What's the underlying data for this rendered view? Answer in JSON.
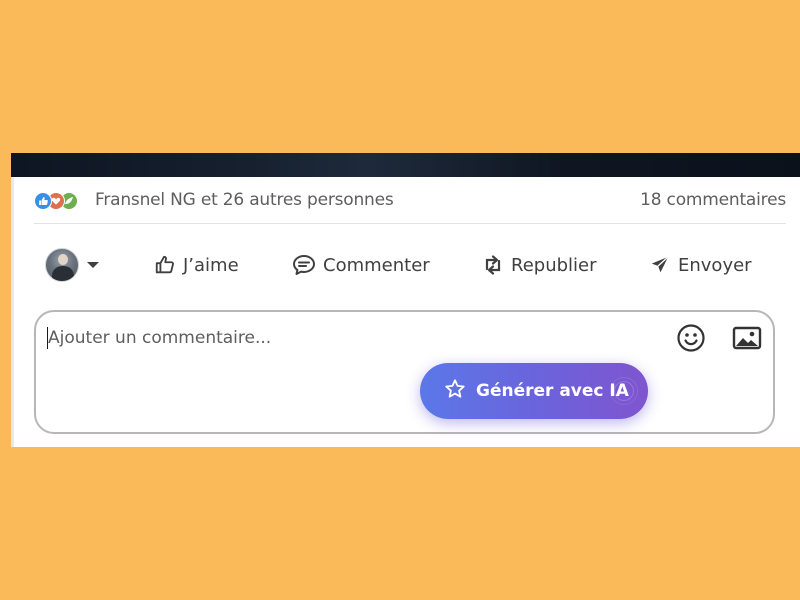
{
  "reactions": {
    "icons": [
      "like-icon",
      "love-icon",
      "support-icon"
    ],
    "summary": "Fransnel NG et 26 autres personnes"
  },
  "comments": {
    "count_label": "18 commentaires"
  },
  "actions": {
    "like": "J’aime",
    "comment": "Commenter",
    "repost": "Republier",
    "send": "Envoyer"
  },
  "composer": {
    "placeholder": "Ajouter un commentaire...",
    "ai_button": "Générer avec IA"
  },
  "colors": {
    "background": "#fbba5a",
    "like": "#378fe9",
    "love": "#df704d",
    "support": "#6dae4f",
    "ai_gradient_start": "#5b78e8",
    "ai_gradient_end": "#7f55cf"
  }
}
